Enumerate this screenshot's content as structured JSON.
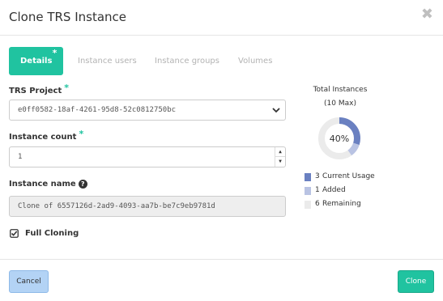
{
  "dialog": {
    "title": "Clone TRS Instance",
    "close_symbol": "✖"
  },
  "tabs": [
    {
      "label": "Details",
      "active": true,
      "required_mark": "*"
    },
    {
      "label": "Instance users",
      "active": false
    },
    {
      "label": "Instance groups",
      "active": false
    },
    {
      "label": "Volumes",
      "active": false
    }
  ],
  "form": {
    "trs_project": {
      "label": "TRS Project",
      "required_mark": "*",
      "value": "e0ff0582-18af-4261-95d8-52c0812750bc"
    },
    "instance_count": {
      "label": "Instance count",
      "required_mark": "*",
      "value": "1"
    },
    "instance_name": {
      "label": "Instance name",
      "value": "Clone of 6557126d-2ad9-4093-aa7b-be7c9eb9781d"
    },
    "full_cloning": {
      "label": "Full Cloning",
      "checked": true
    }
  },
  "quota": {
    "title": "Total Instances",
    "subtitle": "(10 Max)",
    "percent_label": "40%",
    "max": 10,
    "legend": [
      {
        "count": "3",
        "label": "Current Usage",
        "value": 3,
        "color": "#6a80c1"
      },
      {
        "count": "1",
        "label": "Added",
        "value": 1,
        "color": "#b9c3e3"
      },
      {
        "count": "6",
        "label": "Remaining",
        "value": 6,
        "color": "#ebebeb"
      }
    ]
  },
  "footer": {
    "cancel_label": "Cancel",
    "clone_label": "Clone"
  },
  "colors": {
    "accent": "#20c3a0",
    "cancel_bg": "#b3d3f5"
  }
}
